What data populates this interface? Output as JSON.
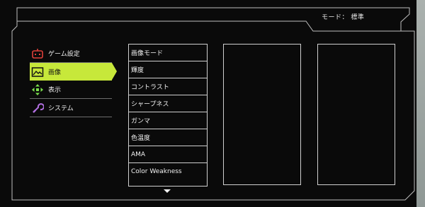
{
  "header": {
    "mode_text": "モード： 標準"
  },
  "main_menu": [
    {
      "label": "ゲーム設定",
      "icon": "game-controller-icon",
      "color": "#e0403a",
      "active": false
    },
    {
      "label": "画像",
      "icon": "picture-icon",
      "color": "#111111",
      "active": true
    },
    {
      "label": "表示",
      "icon": "display-arrows-icon",
      "color": "#7be04c",
      "active": false
    },
    {
      "label": "システム",
      "icon": "wrench-icon",
      "color": "#b16fe0",
      "active": false
    }
  ],
  "sub_menu": [
    "画像モード",
    "輝度",
    "コントラスト",
    "シャープネス",
    "ガンマ",
    "色温度",
    "AMA",
    "Color Weakness"
  ],
  "colors": {
    "accent": "#c7e83a",
    "background": "#0a0a0a",
    "border": "#cfcfcf"
  }
}
